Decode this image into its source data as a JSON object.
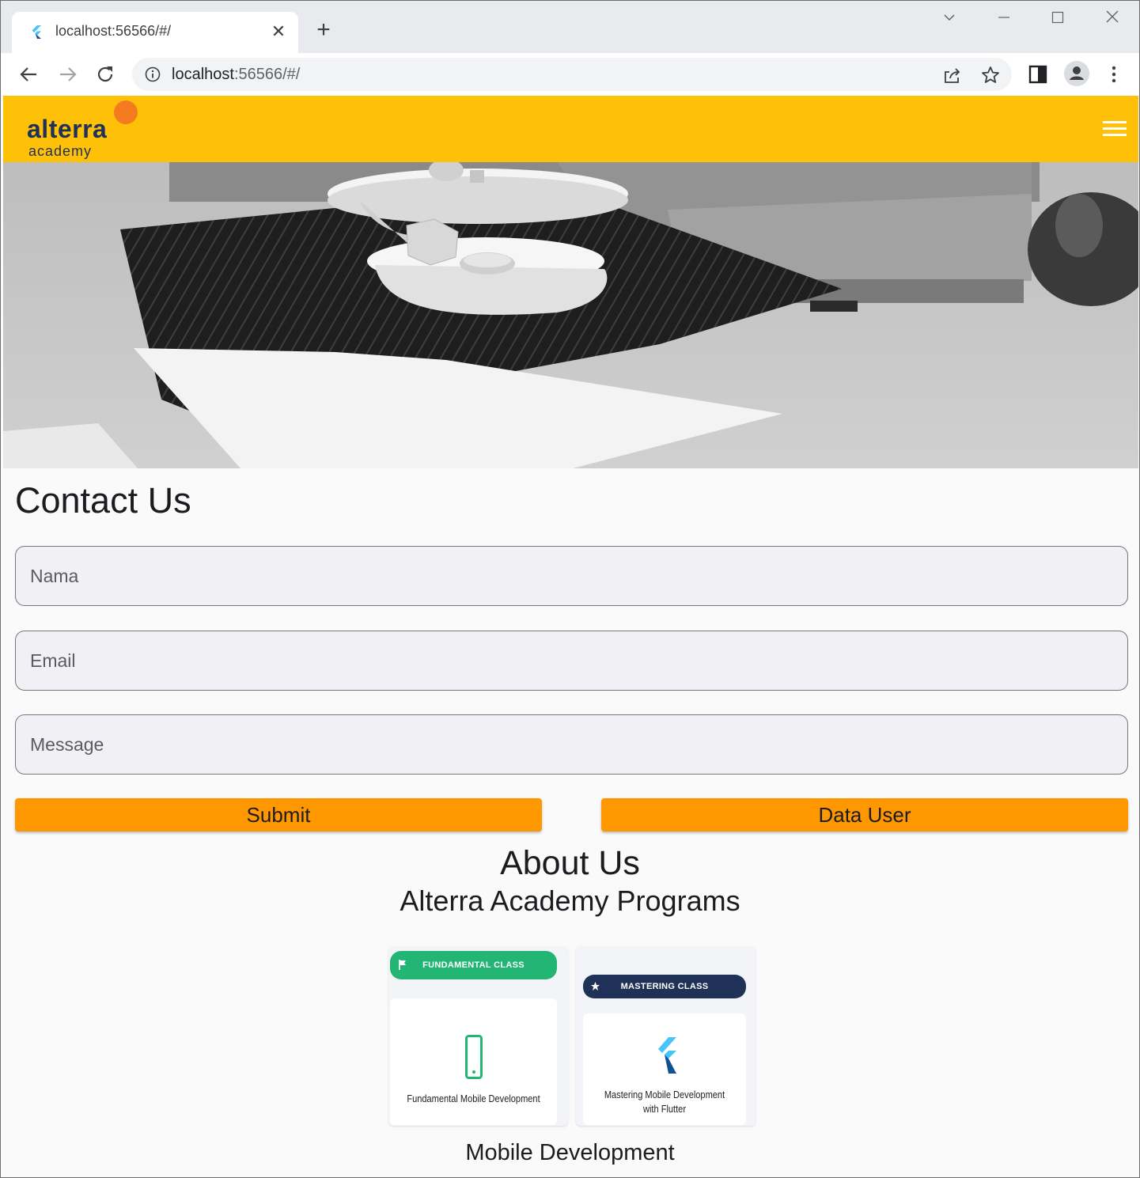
{
  "browser": {
    "tab_title": "localhost:56566/#/",
    "url_host": "localhost",
    "url_path": ":56566/#/"
  },
  "app": {
    "logo_main": "alterra",
    "logo_sub": "academy",
    "brand_color": "#ffc107",
    "accent_color": "#ff9800"
  },
  "contact": {
    "title": "Contact Us",
    "fields": {
      "name_placeholder": "Nama",
      "email_placeholder": "Email",
      "message_placeholder": "Message"
    },
    "submit_label": "Submit",
    "data_user_label": "Data User"
  },
  "about": {
    "title": "About Us",
    "subtitle": "Alterra Academy Programs",
    "cards": [
      {
        "badge": "FUNDAMENTAL CLASS",
        "text": "Fundamental Mobile Development",
        "badge_color": "#22b573",
        "icon": "phone-icon"
      },
      {
        "badge": "MASTERING CLASS",
        "text": "Mastering Mobile Development with Flutter",
        "badge_color": "#1f3157",
        "icon": "flutter-icon"
      }
    ],
    "section_title": "Mobile Development"
  }
}
